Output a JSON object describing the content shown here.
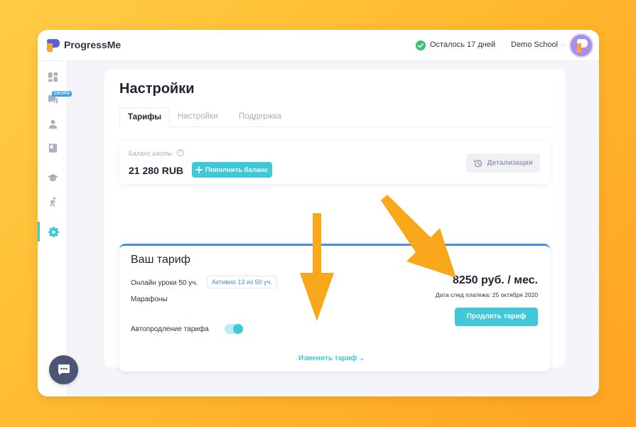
{
  "header": {
    "brand": "ProgressMe",
    "days_left": "Осталось 17 дней",
    "school_name": "Demo School"
  },
  "sidebar": {
    "items": [
      {
        "icon": "dashboard-icon",
        "active": false
      },
      {
        "icon": "chat-bubbles-icon",
        "active": false,
        "badge": "СКОРО"
      },
      {
        "icon": "user-icon",
        "active": false
      },
      {
        "icon": "book-icon",
        "active": false
      },
      {
        "icon": "graduation-cap-icon",
        "active": false
      },
      {
        "icon": "running-person-icon",
        "active": false
      },
      {
        "icon": "gear-icon",
        "active": true
      }
    ]
  },
  "page": {
    "title": "Настройки",
    "tabs": [
      {
        "label": "Тарифы",
        "active": true
      },
      {
        "label": "Настройки",
        "active": false
      },
      {
        "label": "Поддержка",
        "active": false
      }
    ]
  },
  "balance": {
    "label": "Баланс школы",
    "help": "?",
    "value": "21 280 RUB",
    "topup_label": "Пополнить баланс",
    "detail_label": "Детализация"
  },
  "plan": {
    "title": "Ваш тариф",
    "online_lessons": "Онлайн уроки 50 уч.",
    "active_badge": "Активно 13 из 50 уч.",
    "marathons": "Марафоны",
    "price": "8250 руб. / мес.",
    "payment_date": "Дата след платежа: 25 октября 2020",
    "renew_label": "Продлить тариф",
    "autorenew_label": "Автопродление тарифа",
    "autorenew_on": true,
    "change_label": "Изменить тариф"
  },
  "colors": {
    "accent": "#3ec8d8",
    "plan_border": "#4a90e2",
    "arrow": "#f9a81c",
    "background": "#ffc23a"
  }
}
